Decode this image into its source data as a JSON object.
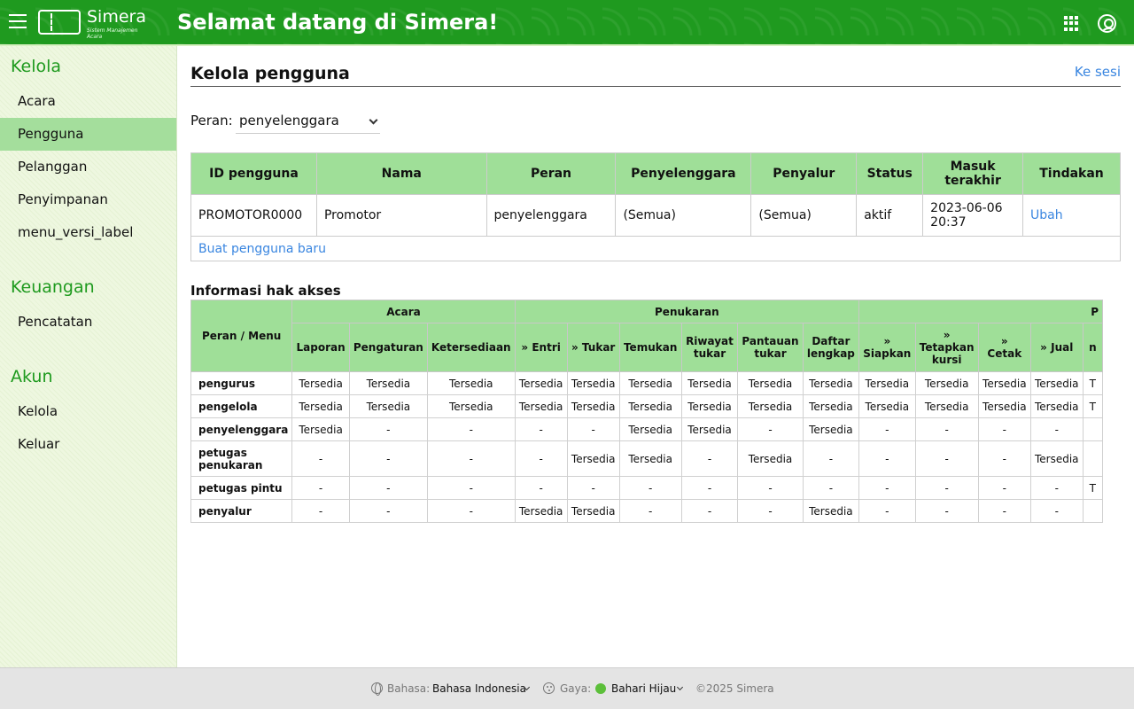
{
  "header": {
    "logo_name": "Simera",
    "logo_tagline": "Sistem Manajemen Acara",
    "title": "Selamat datang di Simera!"
  },
  "sidebar": {
    "groups": [
      {
        "label": "Kelola",
        "items": [
          {
            "label": "Acara"
          },
          {
            "label": "Pengguna",
            "active": true
          },
          {
            "label": "Pelanggan"
          },
          {
            "label": "Penyimpanan"
          },
          {
            "label": "menu_versi_label"
          }
        ]
      },
      {
        "label": "Keuangan",
        "items": [
          {
            "label": "Pencatatan"
          }
        ]
      },
      {
        "label": "Akun",
        "items": [
          {
            "label": "Kelola"
          },
          {
            "label": "Keluar"
          }
        ]
      }
    ]
  },
  "main": {
    "title": "Kelola pengguna",
    "to_session_link": "Ke sesi",
    "role_label": "Peran:",
    "role_value": "penyelenggara",
    "users_table": {
      "headers": [
        "ID pengguna",
        "Nama",
        "Peran",
        "Penyelenggara",
        "Penyalur",
        "Status",
        "Masuk terakhir",
        "Tindakan"
      ],
      "rows": [
        [
          "PROMOTOR0000",
          "Promotor",
          "penyelenggara",
          "(Semua)",
          "(Semua)",
          "aktif",
          "2023-06-06 20:37",
          "Ubah"
        ]
      ],
      "new_user_link": "Buat pengguna baru"
    },
    "access": {
      "title": "Informasi hak akses",
      "corner_header": "Peran / Menu",
      "groups": [
        {
          "label": "Acara",
          "span": 3
        },
        {
          "label": "Penukaran",
          "span": 6
        },
        {
          "label": "P",
          "span": 5
        }
      ],
      "columns": [
        "Laporan",
        "Pengaturan",
        "Ketersediaan",
        "» Entri",
        "» Tukar",
        "Temukan",
        "Riwayat tukar",
        "Pantauan tukar",
        "Daftar lengkap",
        "» Siapkan",
        "» Tetapkan kursi",
        "» Cetak",
        "» Jual",
        "n"
      ],
      "rows": [
        {
          "role": "pengurus",
          "values": [
            "Tersedia",
            "Tersedia",
            "Tersedia",
            "Tersedia",
            "Tersedia",
            "Tersedia",
            "Tersedia",
            "Tersedia",
            "Tersedia",
            "Tersedia",
            "Tersedia",
            "Tersedia",
            "Tersedia",
            "T"
          ]
        },
        {
          "role": "pengelola",
          "values": [
            "Tersedia",
            "Tersedia",
            "Tersedia",
            "Tersedia",
            "Tersedia",
            "Tersedia",
            "Tersedia",
            "Tersedia",
            "Tersedia",
            "Tersedia",
            "Tersedia",
            "Tersedia",
            "Tersedia",
            "T"
          ]
        },
        {
          "role": "penyelenggara",
          "values": [
            "Tersedia",
            "-",
            "-",
            "-",
            "-",
            "Tersedia",
            "Tersedia",
            "-",
            "Tersedia",
            "-",
            "-",
            "-",
            "-",
            ""
          ]
        },
        {
          "role": "petugas penukaran",
          "values": [
            "-",
            "-",
            "-",
            "-",
            "Tersedia",
            "Tersedia",
            "-",
            "Tersedia",
            "-",
            "-",
            "-",
            "-",
            "Tersedia",
            ""
          ]
        },
        {
          "role": "petugas pintu",
          "values": [
            "-",
            "-",
            "-",
            "-",
            "-",
            "-",
            "-",
            "-",
            "-",
            "-",
            "-",
            "-",
            "-",
            "T"
          ]
        },
        {
          "role": "penyalur",
          "values": [
            "-",
            "-",
            "-",
            "Tersedia",
            "Tersedia",
            "-",
            "-",
            "-",
            "Tersedia",
            "-",
            "-",
            "-",
            "-",
            ""
          ]
        }
      ]
    }
  },
  "footer": {
    "language_label": "Bahasa:",
    "language_value": "Bahasa Indonesia",
    "style_label": "Gaya:",
    "style_value": "Bahari Hijau",
    "copyright": "©2025 Simera"
  }
}
